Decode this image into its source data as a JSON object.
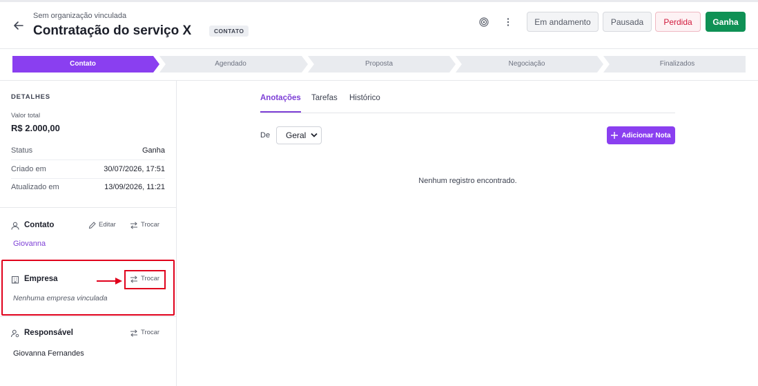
{
  "header": {
    "organization": "Sem organização vinculada",
    "title": "Contratação do serviço X",
    "badge": "CONTATO",
    "status_buttons": {
      "in_progress": "Em andamento",
      "paused": "Pausada",
      "lost": "Perdida",
      "won": "Ganha"
    }
  },
  "pipeline": {
    "stages": [
      "Contato",
      "Agendado",
      "Proposta",
      "Negociação",
      "Finalizados"
    ],
    "active_stage": "Contato",
    "active_color": "#8a3ff0",
    "inactive_color": "#e9ebef"
  },
  "details": {
    "section_title": "DETALHES",
    "total_label": "Valor total",
    "total_value": "R$ 2.000,00",
    "rows": [
      {
        "label": "Status",
        "value": "Ganha"
      },
      {
        "label": "Criado em",
        "value": "30/07/2026, 17:51"
      },
      {
        "label": "Atualizado em",
        "value": "13/09/2026, 11:21"
      }
    ]
  },
  "contact": {
    "title": "Contato",
    "edit_label": "Editar",
    "swap_label": "Trocar",
    "name": "Giovanna"
  },
  "company": {
    "title": "Empresa",
    "swap_label": "Trocar",
    "empty_text": "Nenhuma empresa vinculada"
  },
  "responsible": {
    "title": "Responsável",
    "swap_label": "Trocar",
    "name": "Giovanna Fernandes"
  },
  "main": {
    "tabs": [
      {
        "label": "Anotações",
        "active": true
      },
      {
        "label": "Tarefas",
        "active": false
      },
      {
        "label": "Histórico",
        "active": false
      }
    ],
    "filter_label": "De",
    "filter_value": "Geral",
    "add_note_label": "Adicionar Nota",
    "empty_text": "Nenhum registro encontrado."
  },
  "icons": {
    "back": "arrow-left-icon",
    "target": "target-icon",
    "more": "more-vertical-icon",
    "user": "user-icon",
    "edit": "pencil-icon",
    "swap": "swap-arrows-icon",
    "building": "building-icon",
    "responsible": "user-gear-icon",
    "plus": "plus-icon"
  },
  "colors": {
    "accent": "#8a3ff0",
    "won": "#0f9155",
    "lost": "#d11a3c",
    "annotation": "#e0001b"
  }
}
